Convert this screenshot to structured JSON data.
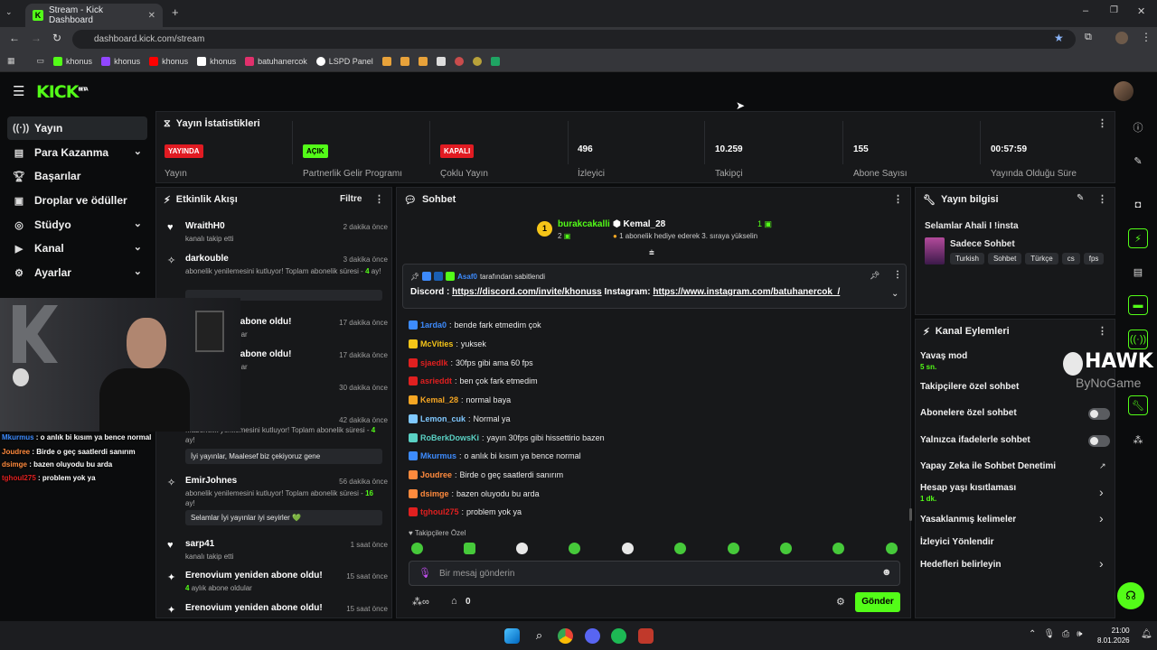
{
  "browser": {
    "tab_title": "Stream - Kick Dashboard",
    "url": "dashboard.kick.com/stream",
    "bookmarks": [
      {
        "label": "khonus",
        "color": "#53fc18"
      },
      {
        "label": "khonus",
        "color": "#9146ff"
      },
      {
        "label": "khonus",
        "color": "#ff0000"
      },
      {
        "label": "khonus",
        "color": "#ffffff"
      },
      {
        "label": "batuhanercok",
        "color": "#e1306c"
      },
      {
        "label": "LSPD Panel",
        "color": "#ffffff"
      }
    ]
  },
  "header": {
    "logo": "KICK",
    "logo_sup": "BETA"
  },
  "sidebar": {
    "items": [
      {
        "label": "Yayın",
        "icon": "broadcast-icon",
        "active": true,
        "chev": false
      },
      {
        "label": "Para Kazanma",
        "icon": "money-icon",
        "chev": true
      },
      {
        "label": "Başarılar",
        "icon": "trophy-icon",
        "chev": false
      },
      {
        "label": "Droplar ve ödüller",
        "icon": "gift-icon",
        "chev": false
      },
      {
        "label": "Stüdyo",
        "icon": "studio-icon",
        "chev": true
      },
      {
        "label": "Kanal",
        "icon": "channel-icon",
        "chev": true
      },
      {
        "label": "Ayarlar",
        "icon": "gear-icon",
        "chev": true
      }
    ]
  },
  "stats": {
    "title": "Yayın İstatistikleri",
    "items": [
      {
        "badge": "YAYINDA",
        "badge_color": "#e11b22",
        "label": "Yayın"
      },
      {
        "badge": "AÇIK",
        "badge_color": "#53fc18",
        "label": "Partnerlik Gelir Programı"
      },
      {
        "badge": "KAPALI",
        "badge_color": "#e11b22",
        "label": "Çoklu Yayın"
      },
      {
        "value": "496",
        "label": "İzleyici"
      },
      {
        "value": "10.259",
        "label": "Takipçi"
      },
      {
        "value": "155",
        "label": "Abone Sayısı"
      },
      {
        "value": "00:57:59",
        "label": "Yayında Olduğu Süre"
      }
    ]
  },
  "activity": {
    "title": "Etkinlik Akışı",
    "filter": "Filtre",
    "items": [
      {
        "name": "WraithH0",
        "time": "2 dakika önce",
        "sub": "kanalı takip etti"
      },
      {
        "name": "darkouble",
        "time": "3 dakika önce",
        "sub": "abonelik yenilemesini kutluyor! Toplam abonelik süresi -",
        "months": "4",
        "sub2": "ay!"
      },
      {
        "name": "...en abone oldu!",
        "time": "17 dakika önce",
        "sub": "...oldular"
      },
      {
        "name": "...en abone oldu!",
        "time": "17 dakika önce",
        "sub": "...oldular"
      },
      {
        "name": "",
        "time": "30 dakika önce",
        "sub": ""
      },
      {
        "name": "",
        "time": "42 dakika önce",
        "sub": "...abonelik yenilemesini kutluyor! Toplam abonelik süresi -",
        "months": "4",
        "sub2": "ay!",
        "box": "İyi yayınlar, Maalesef biz çekiyoruz gene"
      },
      {
        "name": "EmirJohnes",
        "time": "56 dakika önce",
        "sub": "abonelik yenilemesini kutluyor! Toplam abonelik süresi -",
        "months": "16",
        "sub2": "ay!",
        "box": "Selamlar İyi yayınlar iyi seyirler 💚"
      },
      {
        "name": "sarp41",
        "time": "1 saat önce",
        "sub": "kanalı takip etti"
      },
      {
        "name": "Erenovium yeniden abone oldu!",
        "time": "15 saat önce",
        "months": "4",
        "sub": "aylık abone oldular"
      },
      {
        "name": "Erenovium yeniden abone oldu!",
        "time": "15 saat önce",
        "sub": ""
      }
    ]
  },
  "chat": {
    "title": "Sohbet",
    "leader": {
      "rank": "1",
      "name": "burakcakalli",
      "count": "2"
    },
    "gifter": {
      "name": "Kemal_28",
      "count": "1",
      "note": "1 abonelik hediye ederek 3. sıraya yükselin"
    },
    "pinned": {
      "by": "Asaf0",
      "by_suffix": "tarafından sabitlendi",
      "text_a": "Discord : ",
      "link_a": "https://discord.com/invite/khonuss",
      "text_b": " Instagram: ",
      "link_b": "https://www.instagram.com/batuhanercok_/"
    },
    "messages": [
      {
        "user": "1arda0",
        "color": "#3d8bfd",
        "text": "bende fark etmedim çok"
      },
      {
        "user": "McVities",
        "color": "#f5c518",
        "text": "yuksek"
      },
      {
        "user": "sjaedIk",
        "color": "#e02020",
        "text": "30fps gibi ama 60 fps"
      },
      {
        "user": "asrieddt",
        "color": "#e02020",
        "text": "ben çok fark etmedim"
      },
      {
        "user": "Kemal_28",
        "color": "#f5a623",
        "text": "normal baya"
      },
      {
        "user": "Lemon_cuk",
        "color": "#7fc8ff",
        "text": "Normal ya"
      },
      {
        "user": "RoBerkDowsKi",
        "color": "#5ad1c4",
        "text": "yayın 30fps gibi hissettirio bazen"
      },
      {
        "user": "Mkurmus",
        "color": "#3d8bfd",
        "text": "o anlık bi kısım ya bence normal"
      },
      {
        "user": "Joudree",
        "color": "#ff8a3d",
        "text": "Birde o geç saatlerdi sanırım"
      },
      {
        "user": "dsimge",
        "color": "#ff8a3d",
        "text": "bazen oluyodu bu arda"
      },
      {
        "user": "tghoul275",
        "color": "#e02020",
        "text": "problem yok ya"
      }
    ],
    "mode": "Takipçilere Özel",
    "input_placeholder": "Bir mesaj gönderin",
    "points": "0",
    "send": "Gönder"
  },
  "stream_info": {
    "title": "Yayın bilgisi",
    "stream_title": "Selamlar Ahali I !insta",
    "category": "Sadece Sohbet",
    "tags": [
      "Turkish",
      "Sohbet",
      "Türkçe",
      "cs",
      "fps"
    ]
  },
  "channel_actions": {
    "title": "Kanal Eylemleri",
    "items": [
      {
        "label": "Yavaş mod",
        "sub": "5 sn."
      },
      {
        "label": "Takipçilere özel sohbet"
      },
      {
        "label": "Abonelere özel sohbet",
        "toggle": "off"
      },
      {
        "label": "Yalnızca ifadelerle sohbet",
        "toggle": "off"
      },
      {
        "label": "Yapay Zeka ile Sohbet Denetimi"
      },
      {
        "label": "Hesap yaşı kısıtlaması",
        "sub": "1 dk."
      },
      {
        "label": "Yasaklanmış kelimeler"
      },
      {
        "label": "İzleyici Yönlendir"
      },
      {
        "label": "Hedefleri belirleyin"
      }
    ]
  },
  "overlay": {
    "watermark_a": "HAWK",
    "watermark_b": "ByNoGame",
    "chat": [
      {
        "user": "Mkurmus",
        "text": "o anlık bi kısım ya bence normal",
        "color": "#3d8bfd"
      },
      {
        "user": "Joudree",
        "text": "Birde o geç saatlerdi sanırım",
        "color": "#ff8a3d"
      },
      {
        "user": "dsimge",
        "text": "bazen oluyodu bu arda",
        "color": "#ff8a3d"
      },
      {
        "user": "tghoul275",
        "text": "problem yok ya",
        "color": "#e02020"
      }
    ]
  },
  "taskbar": {
    "time": "21:00",
    "date": "8.01.2026"
  }
}
